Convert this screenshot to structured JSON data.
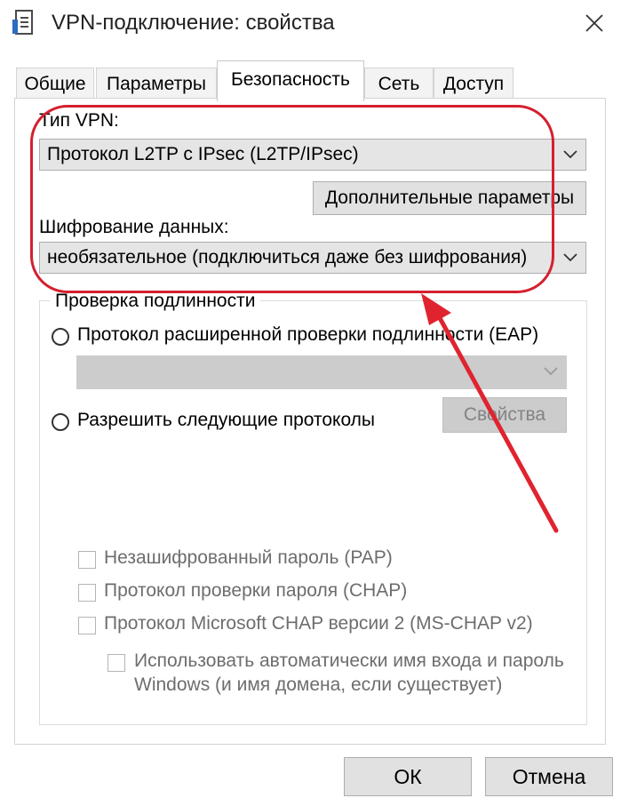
{
  "window": {
    "title": "VPN-подключение: свойства",
    "app_icon": "document-icon",
    "close_icon": "close-icon"
  },
  "tabs": [
    {
      "label": "Общие"
    },
    {
      "label": "Параметры"
    },
    {
      "label": "Безопасность",
      "active": true
    },
    {
      "label": "Сеть"
    },
    {
      "label": "Доступ"
    }
  ],
  "vpn": {
    "type_label": "Тип VPN:",
    "type_value": "Протокол L2TP с IPsec (L2TP/IPsec)",
    "advanced_button": "Дополнительные параметры",
    "encryption_label": "Шифрование данных:",
    "encryption_value": "необязательное (подключиться даже без шифрования)"
  },
  "auth": {
    "group_title": "Проверка подлинности",
    "eap_radio": "Протокол расширенной проверки подлинности (EAP)",
    "eap_combo_value": "",
    "allow_radio": "Разрешить следующие протоколы",
    "properties_button": "Свойства",
    "pap": "Незашифрованный пароль (PAP)",
    "chap": "Протокол проверки пароля (CHAP)",
    "mschap": "Протокол Microsoft CHAP версии 2 (MS-CHAP v2)",
    "auto_login_line1": "Использовать автоматически имя входа и пароль",
    "auto_login_line2": "Windows (и имя домена, если существует)"
  },
  "footer": {
    "ok_button": "ОК",
    "cancel_button": "Отмена"
  },
  "annotation": {
    "color": "#d4202e"
  }
}
